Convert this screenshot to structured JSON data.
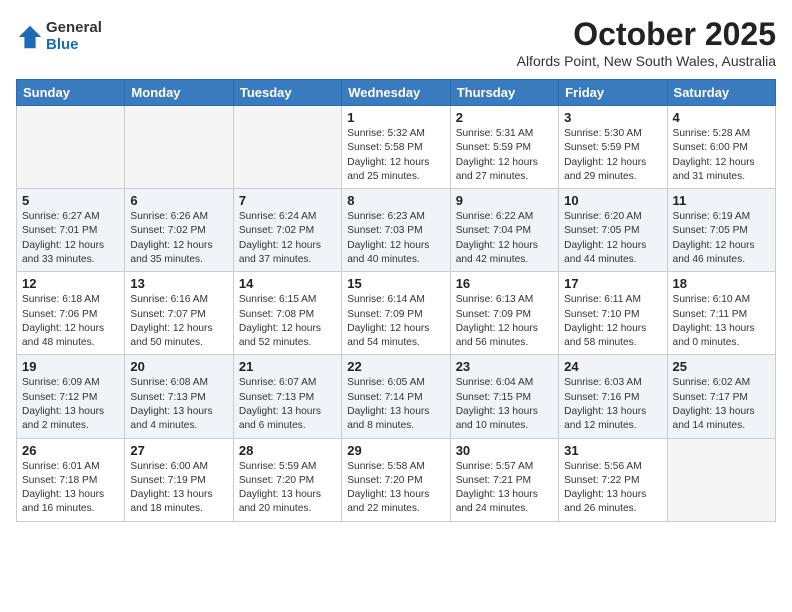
{
  "logo": {
    "general": "General",
    "blue": "Blue"
  },
  "header": {
    "month": "October 2025",
    "location": "Alfords Point, New South Wales, Australia"
  },
  "weekdays": [
    "Sunday",
    "Monday",
    "Tuesday",
    "Wednesday",
    "Thursday",
    "Friday",
    "Saturday"
  ],
  "weeks": [
    [
      {
        "day": "",
        "info": ""
      },
      {
        "day": "",
        "info": ""
      },
      {
        "day": "",
        "info": ""
      },
      {
        "day": "1",
        "info": "Sunrise: 5:32 AM\nSunset: 5:58 PM\nDaylight: 12 hours\nand 25 minutes."
      },
      {
        "day": "2",
        "info": "Sunrise: 5:31 AM\nSunset: 5:59 PM\nDaylight: 12 hours\nand 27 minutes."
      },
      {
        "day": "3",
        "info": "Sunrise: 5:30 AM\nSunset: 5:59 PM\nDaylight: 12 hours\nand 29 minutes."
      },
      {
        "day": "4",
        "info": "Sunrise: 5:28 AM\nSunset: 6:00 PM\nDaylight: 12 hours\nand 31 minutes."
      }
    ],
    [
      {
        "day": "5",
        "info": "Sunrise: 6:27 AM\nSunset: 7:01 PM\nDaylight: 12 hours\nand 33 minutes."
      },
      {
        "day": "6",
        "info": "Sunrise: 6:26 AM\nSunset: 7:02 PM\nDaylight: 12 hours\nand 35 minutes."
      },
      {
        "day": "7",
        "info": "Sunrise: 6:24 AM\nSunset: 7:02 PM\nDaylight: 12 hours\nand 37 minutes."
      },
      {
        "day": "8",
        "info": "Sunrise: 6:23 AM\nSunset: 7:03 PM\nDaylight: 12 hours\nand 40 minutes."
      },
      {
        "day": "9",
        "info": "Sunrise: 6:22 AM\nSunset: 7:04 PM\nDaylight: 12 hours\nand 42 minutes."
      },
      {
        "day": "10",
        "info": "Sunrise: 6:20 AM\nSunset: 7:05 PM\nDaylight: 12 hours\nand 44 minutes."
      },
      {
        "day": "11",
        "info": "Sunrise: 6:19 AM\nSunset: 7:05 PM\nDaylight: 12 hours\nand 46 minutes."
      }
    ],
    [
      {
        "day": "12",
        "info": "Sunrise: 6:18 AM\nSunset: 7:06 PM\nDaylight: 12 hours\nand 48 minutes."
      },
      {
        "day": "13",
        "info": "Sunrise: 6:16 AM\nSunset: 7:07 PM\nDaylight: 12 hours\nand 50 minutes."
      },
      {
        "day": "14",
        "info": "Sunrise: 6:15 AM\nSunset: 7:08 PM\nDaylight: 12 hours\nand 52 minutes."
      },
      {
        "day": "15",
        "info": "Sunrise: 6:14 AM\nSunset: 7:09 PM\nDaylight: 12 hours\nand 54 minutes."
      },
      {
        "day": "16",
        "info": "Sunrise: 6:13 AM\nSunset: 7:09 PM\nDaylight: 12 hours\nand 56 minutes."
      },
      {
        "day": "17",
        "info": "Sunrise: 6:11 AM\nSunset: 7:10 PM\nDaylight: 12 hours\nand 58 minutes."
      },
      {
        "day": "18",
        "info": "Sunrise: 6:10 AM\nSunset: 7:11 PM\nDaylight: 13 hours\nand 0 minutes."
      }
    ],
    [
      {
        "day": "19",
        "info": "Sunrise: 6:09 AM\nSunset: 7:12 PM\nDaylight: 13 hours\nand 2 minutes."
      },
      {
        "day": "20",
        "info": "Sunrise: 6:08 AM\nSunset: 7:13 PM\nDaylight: 13 hours\nand 4 minutes."
      },
      {
        "day": "21",
        "info": "Sunrise: 6:07 AM\nSunset: 7:13 PM\nDaylight: 13 hours\nand 6 minutes."
      },
      {
        "day": "22",
        "info": "Sunrise: 6:05 AM\nSunset: 7:14 PM\nDaylight: 13 hours\nand 8 minutes."
      },
      {
        "day": "23",
        "info": "Sunrise: 6:04 AM\nSunset: 7:15 PM\nDaylight: 13 hours\nand 10 minutes."
      },
      {
        "day": "24",
        "info": "Sunrise: 6:03 AM\nSunset: 7:16 PM\nDaylight: 13 hours\nand 12 minutes."
      },
      {
        "day": "25",
        "info": "Sunrise: 6:02 AM\nSunset: 7:17 PM\nDaylight: 13 hours\nand 14 minutes."
      }
    ],
    [
      {
        "day": "26",
        "info": "Sunrise: 6:01 AM\nSunset: 7:18 PM\nDaylight: 13 hours\nand 16 minutes."
      },
      {
        "day": "27",
        "info": "Sunrise: 6:00 AM\nSunset: 7:19 PM\nDaylight: 13 hours\nand 18 minutes."
      },
      {
        "day": "28",
        "info": "Sunrise: 5:59 AM\nSunset: 7:20 PM\nDaylight: 13 hours\nand 20 minutes."
      },
      {
        "day": "29",
        "info": "Sunrise: 5:58 AM\nSunset: 7:20 PM\nDaylight: 13 hours\nand 22 minutes."
      },
      {
        "day": "30",
        "info": "Sunrise: 5:57 AM\nSunset: 7:21 PM\nDaylight: 13 hours\nand 24 minutes."
      },
      {
        "day": "31",
        "info": "Sunrise: 5:56 AM\nSunset: 7:22 PM\nDaylight: 13 hours\nand 26 minutes."
      },
      {
        "day": "",
        "info": ""
      }
    ]
  ]
}
